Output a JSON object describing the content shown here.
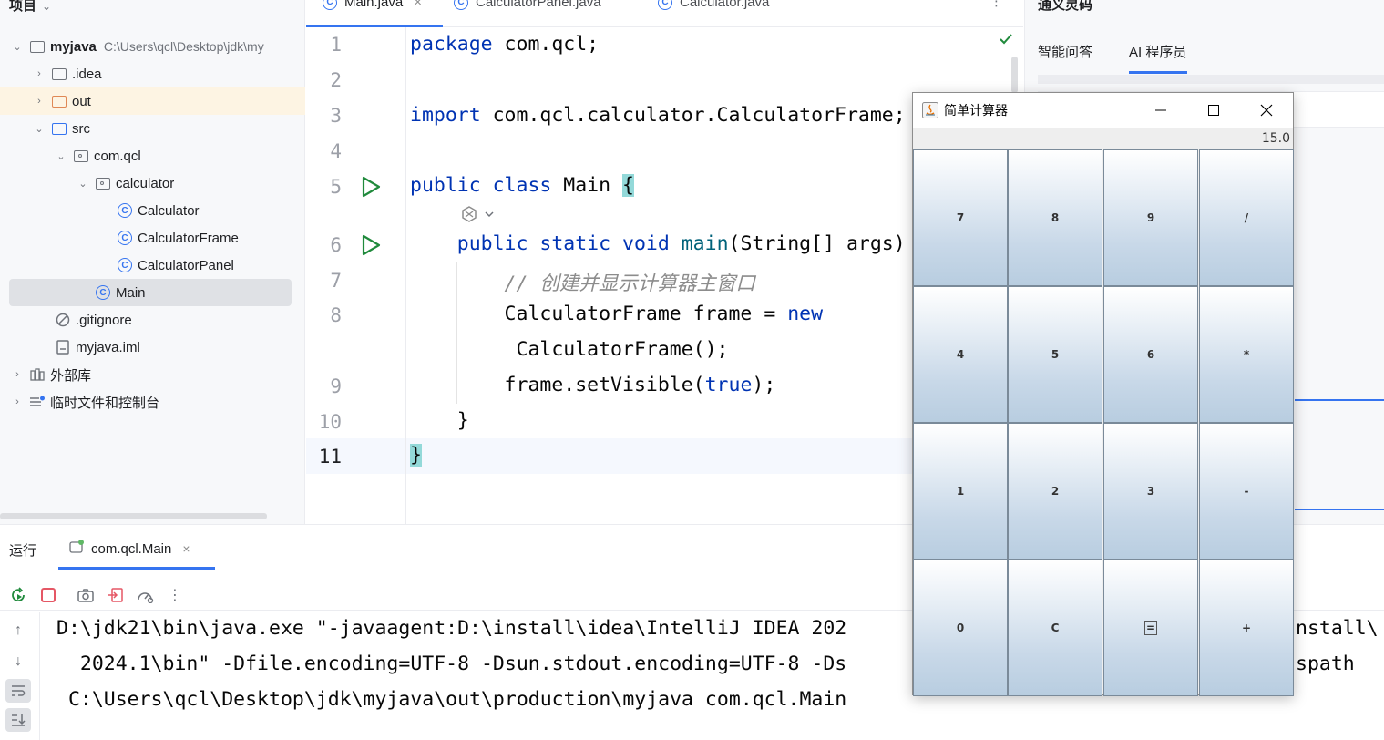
{
  "project": {
    "header": "项目",
    "items": [
      {
        "label": "myjava",
        "path": "C:\\Users\\qcl\\Desktop\\jdk\\my"
      },
      {
        "label": ".idea"
      },
      {
        "label": "out"
      },
      {
        "label": "src"
      },
      {
        "label": "com.qcl"
      },
      {
        "label": "calculator"
      },
      {
        "label": "Calculator"
      },
      {
        "label": "CalculatorFrame"
      },
      {
        "label": "CalculatorPanel"
      },
      {
        "label": "Main"
      },
      {
        "label": ".gitignore"
      },
      {
        "label": "myjava.iml"
      },
      {
        "label": "外部库"
      },
      {
        "label": "临时文件和控制台"
      }
    ]
  },
  "editor": {
    "tabs": [
      {
        "label": "Main.java"
      },
      {
        "label": "CalculatorPanel.java"
      },
      {
        "label": "Calculator.java"
      }
    ],
    "tabs_more": "⋮",
    "line_numbers": [
      "1",
      "2",
      "3",
      "4",
      "5",
      "6",
      "7",
      "8",
      "9",
      "10",
      "11"
    ]
  },
  "ai_panel": {
    "title": "通义灵码",
    "tabs": [
      {
        "label": "智能问答"
      },
      {
        "label": "AI 程序员"
      }
    ]
  },
  "run": {
    "title": "运行",
    "tab_label": "com.qcl.Main",
    "tab_close": "×",
    "console": [
      "D:\\jdk21\\bin\\java.exe \"-javaagent:D:\\install\\idea\\IntelliJ IDEA 202",
      "  2024.1\\bin\" -Dfile.encoding=UTF-8 -Dsun.stdout.encoding=UTF-8 -Ds",
      " C:\\Users\\qcl\\Desktop\\jdk\\myjava\\out\\production\\myjava com.qcl.Main"
    ],
    "console_right": [
      "nstall\\",
      "spath"
    ]
  },
  "calculator": {
    "title": "简单计算器",
    "display": "15.0",
    "keys": [
      "7",
      "8",
      "9",
      "/",
      "4",
      "5",
      "6",
      "*",
      "1",
      "2",
      "3",
      "-",
      "0",
      "C",
      "=",
      "+"
    ]
  },
  "colors": {
    "accent": "#3574f0",
    "keyword": "#0033b3",
    "function": "#00627a",
    "comment": "#8c8c8c",
    "run_green": "#208a3c",
    "stop_red": "#e55765"
  }
}
